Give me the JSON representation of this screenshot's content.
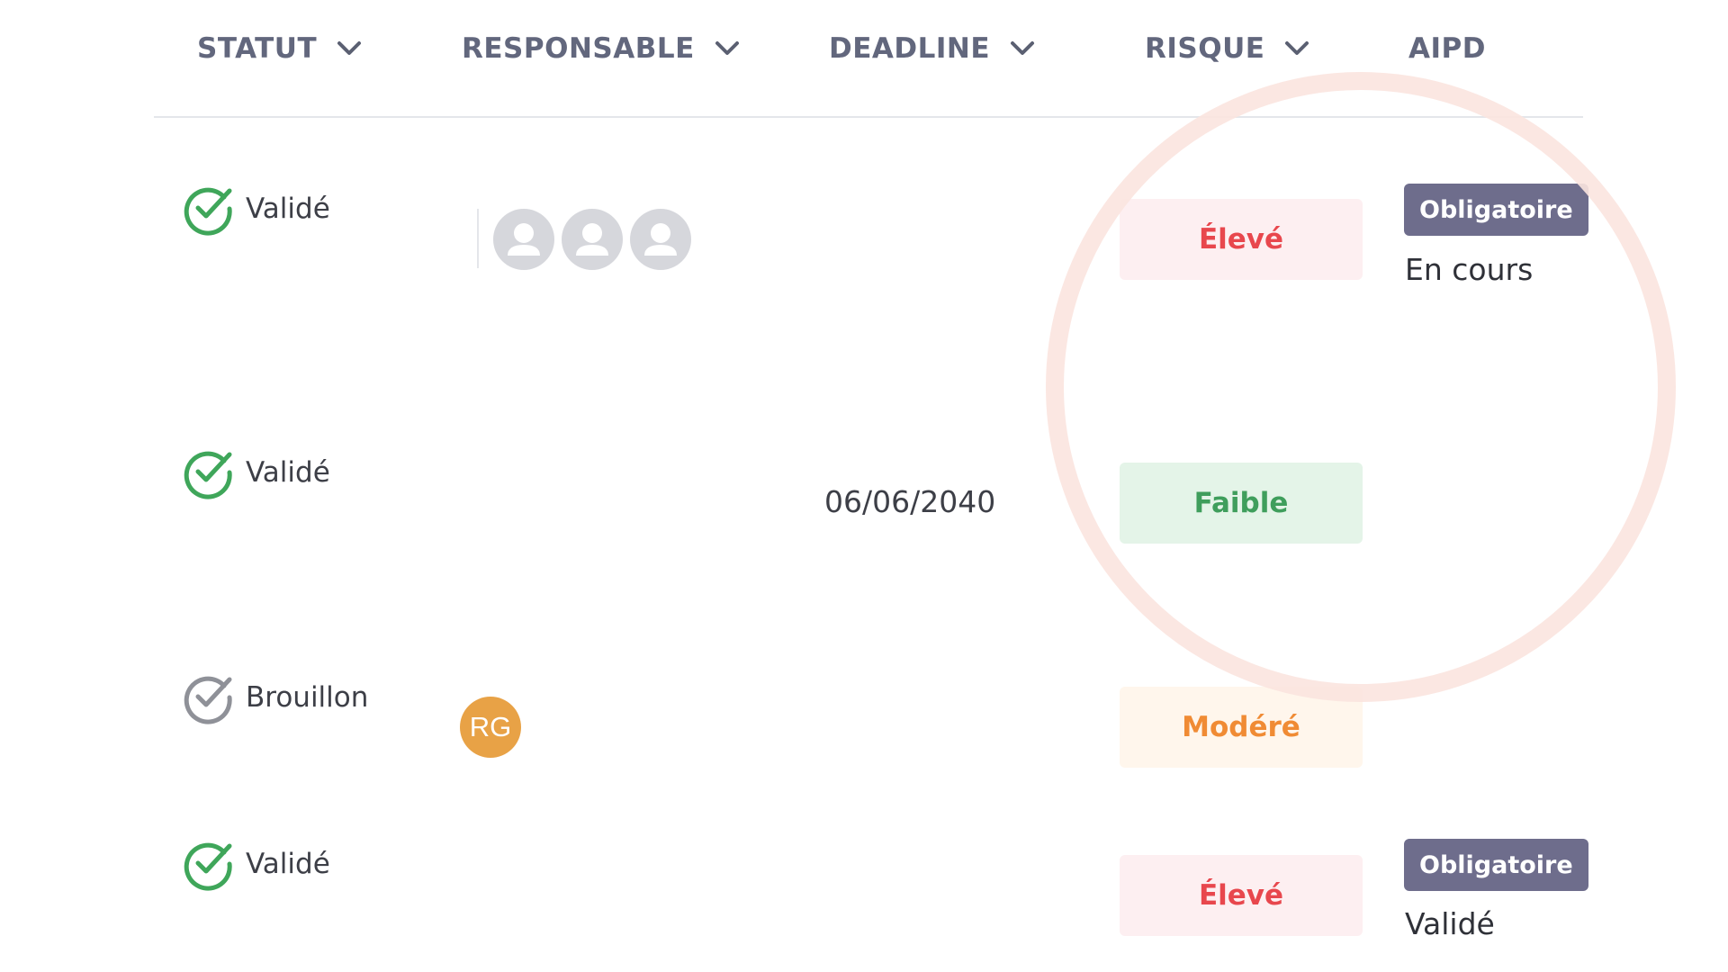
{
  "header": {
    "columns": [
      {
        "label": "STATUT",
        "sortable": true
      },
      {
        "label": "RESPONSABLE",
        "sortable": true
      },
      {
        "label": "DEADLINE",
        "sortable": true
      },
      {
        "label": "RISQUE",
        "sortable": true
      },
      {
        "label": "AIPD",
        "sortable": false
      }
    ]
  },
  "rows": [
    {
      "status": "Validé",
      "status_state": "validated",
      "responsable": "3 placeholder avatars",
      "deadline": "",
      "risk": "Élevé",
      "aipd_badge": "Obligatoire",
      "aipd_status": "En cours"
    },
    {
      "status": "Validé",
      "status_state": "validated",
      "responsable": "",
      "deadline": "06/06/2040",
      "risk": "Faible",
      "aipd_badge": "",
      "aipd_status": ""
    },
    {
      "status": "Brouillon",
      "status_state": "draft",
      "responsable_initials": "RG",
      "deadline": "",
      "risk": "Modéré",
      "aipd_badge": "",
      "aipd_status": ""
    },
    {
      "status": "Validé",
      "status_state": "validated",
      "responsable": "",
      "deadline": "",
      "risk": "Élevé",
      "aipd_badge": "Obligatoire",
      "aipd_status": "Validé"
    }
  ],
  "colors": {
    "validated_check": "#3fa65a",
    "draft_check": "#8f9198",
    "risk_high_text": "#e8474d",
    "risk_high_bg": "#fdeff1",
    "risk_low_text": "#3f9e5c",
    "risk_low_bg": "#e4f4e8",
    "risk_mid_text": "#f08b34",
    "risk_mid_bg": "#fff6ec",
    "aipd_badge_bg": "#6e6d8c",
    "avatar_rg_bg": "#e8a246",
    "highlight_ring": "#fbe4df"
  }
}
